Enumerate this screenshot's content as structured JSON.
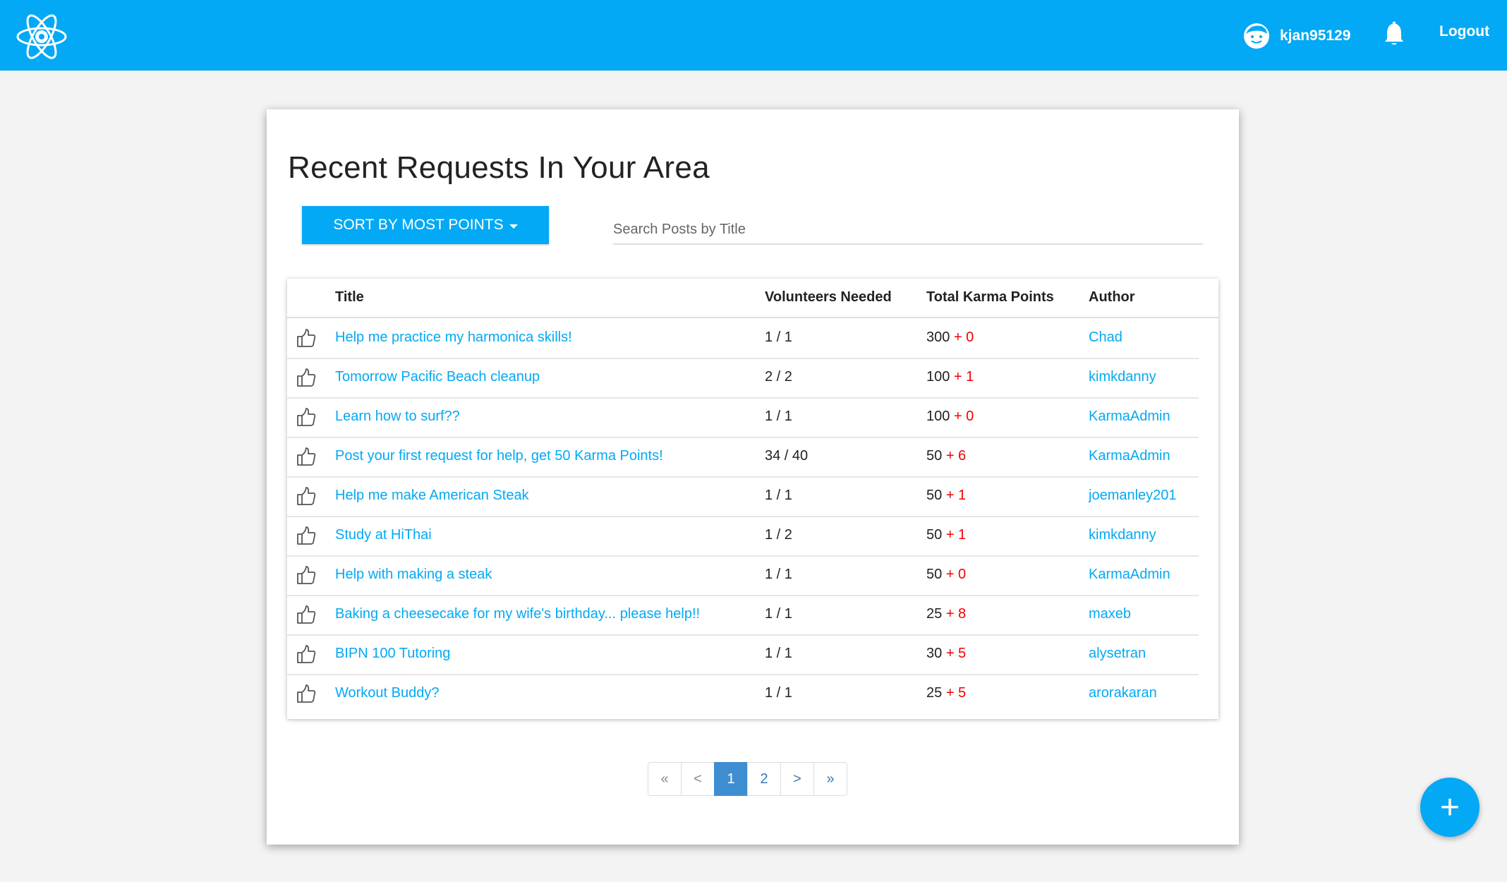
{
  "navbar": {
    "logo_icon": "atom-logo-icon",
    "username": "kjan95129",
    "avatar_icon": "smiley-avatar-icon",
    "bell_icon": "bell-icon",
    "logout_label": "Logout"
  },
  "page": {
    "title": "Recent Requests In Your Area",
    "sort_label": "SORT BY MOST POINTS",
    "search_placeholder": "Search Posts by Title"
  },
  "table": {
    "headers": {
      "title": "Title",
      "volunteers": "Volunteers Needed",
      "points": "Total Karma Points",
      "author": "Author"
    },
    "rows": [
      {
        "title": "Help me practice my harmonica skills!",
        "volunteers": "1 / 1",
        "points": "300",
        "plus": "+ 0",
        "author": "Chad"
      },
      {
        "title": "Tomorrow Pacific Beach cleanup",
        "volunteers": "2 / 2",
        "points": "100",
        "plus": "+ 1",
        "author": "kimkdanny"
      },
      {
        "title": "Learn how to surf??",
        "volunteers": "1 / 1",
        "points": "100",
        "plus": "+ 0",
        "author": "KarmaAdmin"
      },
      {
        "title": "Post your first request for help, get 50 Karma Points!",
        "volunteers": "34 / 40",
        "points": "50",
        "plus": "+ 6",
        "author": "KarmaAdmin"
      },
      {
        "title": "Help me make American Steak",
        "volunteers": "1 / 1",
        "points": "50",
        "plus": "+ 1",
        "author": "joemanley201"
      },
      {
        "title": "Study at HiThai",
        "volunteers": "1 / 2",
        "points": "50",
        "plus": "+ 1",
        "author": "kimkdanny"
      },
      {
        "title": "Help with making a steak",
        "volunteers": "1 / 1",
        "points": "50",
        "plus": "+ 0",
        "author": "KarmaAdmin"
      },
      {
        "title": "Baking a cheesecake for my wife's birthday... please help!!",
        "volunteers": "1 / 1",
        "points": "25",
        "plus": "+ 8",
        "author": "maxeb"
      },
      {
        "title": "BIPN 100 Tutoring",
        "volunteers": "1 / 1",
        "points": "30",
        "plus": "+ 5",
        "author": "alysetran"
      },
      {
        "title": "Workout Buddy?",
        "volunteers": "1 / 1",
        "points": "25",
        "plus": "+ 5",
        "author": "arorakaran"
      }
    ]
  },
  "pagination": {
    "first": "«",
    "prev": "<",
    "pages": [
      "1",
      "2"
    ],
    "current": "1",
    "next": ">",
    "last": "»"
  },
  "fab": {
    "label": "+",
    "icon": "plus-icon"
  },
  "colors": {
    "primary": "#03a9f4",
    "plus_red": "#f20000",
    "page_active": "#3f8ed2",
    "background": "#f3f3f3"
  }
}
